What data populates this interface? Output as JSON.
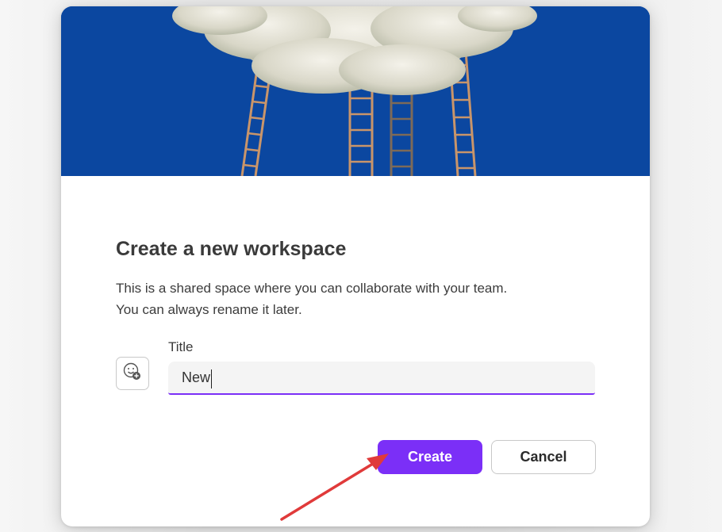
{
  "dialog": {
    "title": "Create a new workspace",
    "description_line1": "This is a shared space where you can collaborate with your team.",
    "description_line2": "You can always rename it later.",
    "emoji_icon": "add-emoji-icon",
    "title_field": {
      "label": "Title",
      "value": "New"
    },
    "create_label": "Create",
    "cancel_label": "Cancel"
  },
  "colors": {
    "accent": "#7b2ff7",
    "hero_background": "#0b47a0",
    "annotation_arrow": "#e03a3a"
  }
}
